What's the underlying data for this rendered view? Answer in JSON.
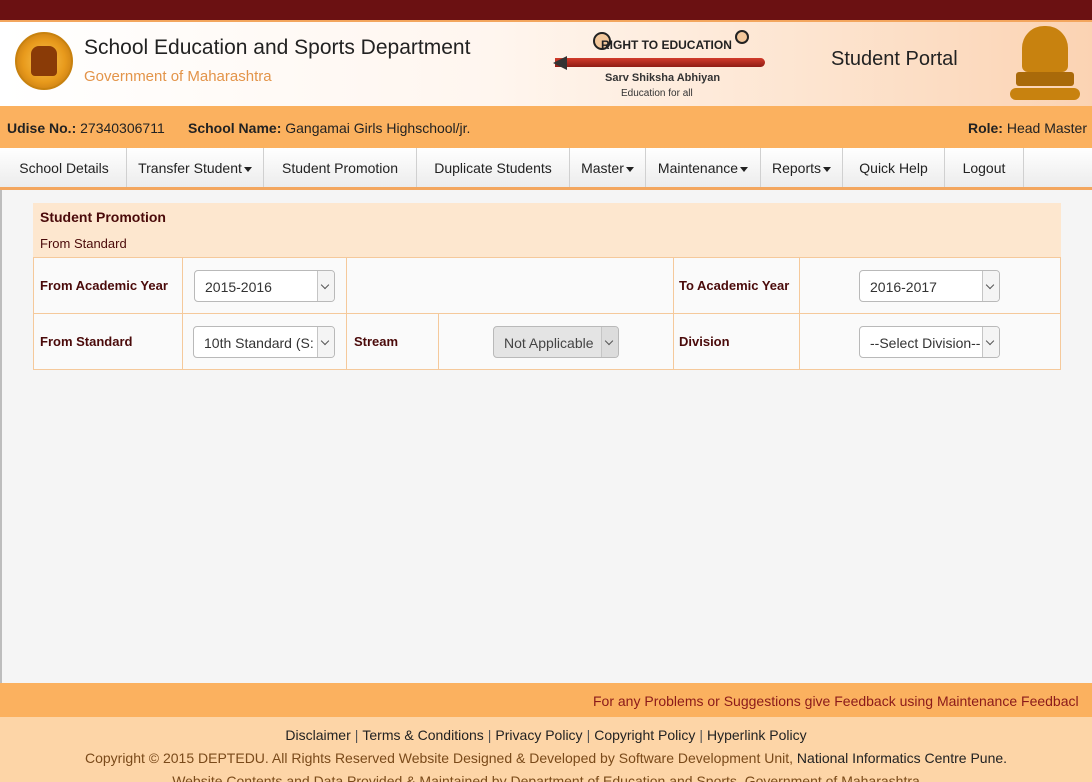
{
  "header": {
    "dept_title": "School Education and Sports Department",
    "dept_subtitle": "Government of Maharashtra",
    "rte_text": "RIGHT TO EDUCATION",
    "rte_ssa": "Sarv Shiksha Abhiyan",
    "rte_tagline": "Education for all",
    "portal_title": "Student Portal"
  },
  "info": {
    "udise_label": "Udise No.:",
    "udise_value": "27340306711",
    "school_label": "School Name:",
    "school_value": "Gangamai Girls Highschool/jr.",
    "role_label": "Role:",
    "role_value": "Head Master"
  },
  "nav": {
    "school_details": "School Details",
    "transfer_student": "Transfer Student",
    "student_promotion": "Student Promotion",
    "duplicate_students": "Duplicate Students",
    "master": "Master",
    "maintenance": "Maintenance",
    "reports": "Reports",
    "quick_help": "Quick Help",
    "logout": "Logout"
  },
  "panel": {
    "title": "Student Promotion",
    "subtitle": "From Standard"
  },
  "form": {
    "from_academic_year_label": "From Academic Year",
    "from_academic_year_value": "2015-2016",
    "to_academic_year_label": "To Academic Year",
    "to_academic_year_value": "2016-2017",
    "from_standard_label": "From Standard",
    "from_standard_value": "10th Standard (S:",
    "stream_label": "Stream",
    "stream_value": "Not Applicable",
    "division_label": "Division",
    "division_value": "--Select Division--"
  },
  "footer": {
    "feedback": "For any Problems or Suggestions give Feedback using Maintenance Feedbacl",
    "disclaimer": "Disclaimer",
    "terms": "Terms & Conditions",
    "privacy": "Privacy Policy",
    "copyright_policy": "Copyright Policy",
    "hyperlink": "Hyperlink Policy",
    "separator": "|",
    "copyright": "Copyright © 2015 DEPTEDU. All Rights Reserved Website Designed & Developed by Software Development Unit, ",
    "nic": "National Informatics Centre Pune.",
    "maintained": "Website Contents and Data Provided & Maintained by Department of Education and Sports, Government of Maharashtra"
  },
  "colors": {
    "top_bar": "#6b1112",
    "accent": "#fbb15f",
    "label_text": "#4a0a0a"
  }
}
